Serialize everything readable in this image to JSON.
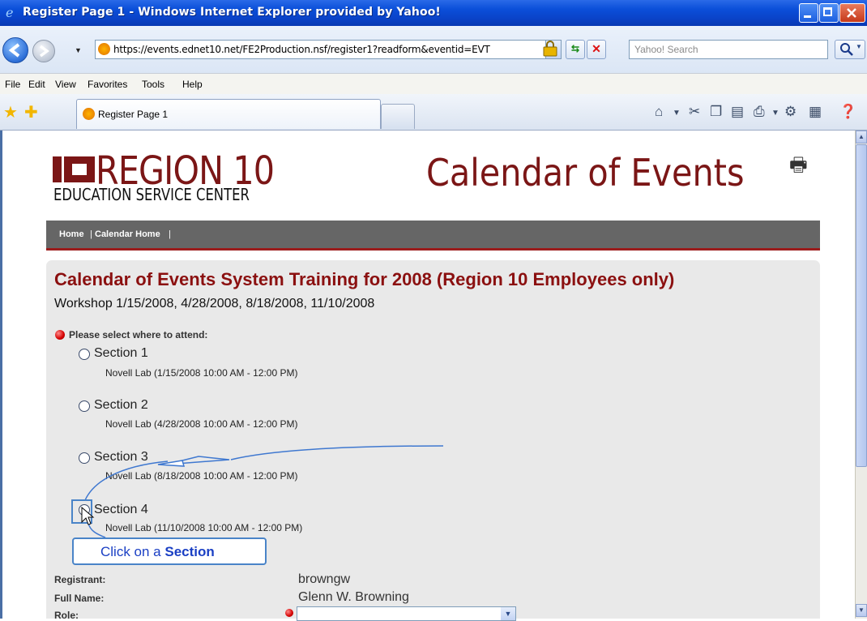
{
  "window": {
    "title": "Register Page 1 - Windows Internet Explorer provided by Yahoo!"
  },
  "address": {
    "url": "https://events.ednet10.net/FE2Production.nsf/register1?readform&eventid=EVT",
    "search_placeholder": "Yahoo! Search"
  },
  "menu": [
    "File",
    "Edit",
    "View",
    "Favorites",
    "Tools",
    "Help"
  ],
  "tab": {
    "label": "Register Page 1"
  },
  "header": {
    "logo_title": "REGION 10",
    "logo_subtitle": "EDUCATION SERVICE CENTER",
    "site_title": "Calendar of Events"
  },
  "nav": {
    "home": "Home",
    "sep1": "|",
    "calendar_home": "Calendar Home",
    "sep2": "|"
  },
  "event": {
    "title": "Calendar of Events System Training for 2008 (Region 10 Employees only)",
    "workshop": "Workshop  1/15/2008, 4/28/2008, 8/18/2008, 11/10/2008",
    "select_prompt": "Please select where to attend:",
    "sections": [
      {
        "label": "Section 1",
        "detail": "Novell Lab (1/15/2008 10:00 AM - 12:00 PM)"
      },
      {
        "label": "Section 2",
        "detail": "Novell Lab (4/28/2008 10:00 AM - 12:00 PM)"
      },
      {
        "label": "Section 3",
        "detail": "Novell Lab (8/18/2008 10:00 AM - 12:00 PM)"
      },
      {
        "label": "Section 4",
        "detail": "Novell Lab (11/10/2008 10:00 AM - 12:00 PM)"
      }
    ]
  },
  "annotation": {
    "prefix": "Click on a ",
    "emphasis": "Section"
  },
  "form": {
    "registrant_label": "Registrant:",
    "registrant_value": "browngw",
    "fullname_label": "Full Name:",
    "fullname_value": "Glenn W. Browning",
    "role_label": "Role:"
  },
  "colors": {
    "brand_red": "#7b1616",
    "title_red": "#8b1010",
    "titlebar_blue": "#0a43c9",
    "callout_blue": "#1a3fc4"
  }
}
